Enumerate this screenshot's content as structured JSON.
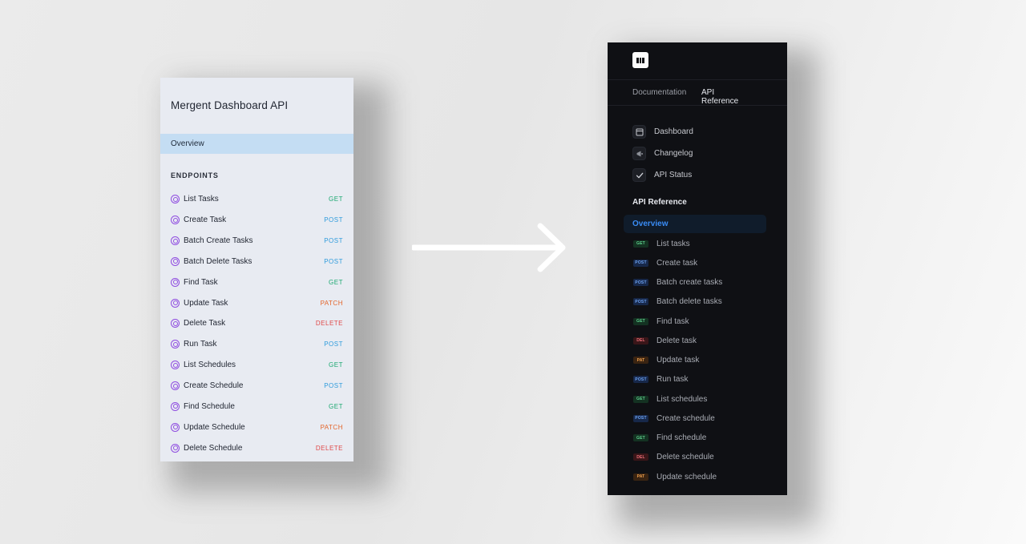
{
  "left_panel": {
    "title": "Mergent Dashboard API",
    "overview": "Overview",
    "section": "ENDPOINTS",
    "items": [
      {
        "label": "List Tasks",
        "method": "GET",
        "kind": "get"
      },
      {
        "label": "Create Task",
        "method": "POST",
        "kind": "post"
      },
      {
        "label": "Batch Create Tasks",
        "method": "POST",
        "kind": "post"
      },
      {
        "label": "Batch Delete Tasks",
        "method": "POST",
        "kind": "post"
      },
      {
        "label": "Find Task",
        "method": "GET",
        "kind": "get"
      },
      {
        "label": "Update Task",
        "method": "PATCH",
        "kind": "patch"
      },
      {
        "label": "Delete Task",
        "method": "DELETE",
        "kind": "delete"
      },
      {
        "label": "Run Task",
        "method": "POST",
        "kind": "post"
      },
      {
        "label": "List Schedules",
        "method": "GET",
        "kind": "get"
      },
      {
        "label": "Create Schedule",
        "method": "POST",
        "kind": "post"
      },
      {
        "label": "Find Schedule",
        "method": "GET",
        "kind": "get"
      },
      {
        "label": "Update Schedule",
        "method": "PATCH",
        "kind": "patch"
      },
      {
        "label": "Delete Schedule",
        "method": "DELETE",
        "kind": "delete"
      }
    ]
  },
  "right_panel": {
    "tabs": {
      "documentation": "Documentation",
      "api_reference": "API Reference"
    },
    "nav": [
      {
        "label": "Dashboard",
        "icon": "layout-icon"
      },
      {
        "label": "Changelog",
        "icon": "megaphone-icon"
      },
      {
        "label": "API Status",
        "icon": "check-icon"
      }
    ],
    "section": "API Reference",
    "overview": "Overview",
    "items": [
      {
        "label": "List tasks",
        "badge": "GET",
        "kind": "get"
      },
      {
        "label": "Create task",
        "badge": "POST",
        "kind": "post"
      },
      {
        "label": "Batch create tasks",
        "badge": "POST",
        "kind": "post"
      },
      {
        "label": "Batch delete tasks",
        "badge": "POST",
        "kind": "post"
      },
      {
        "label": "Find task",
        "badge": "GET",
        "kind": "get"
      },
      {
        "label": "Delete task",
        "badge": "DEL",
        "kind": "del"
      },
      {
        "label": "Update task",
        "badge": "PAT",
        "kind": "pat"
      },
      {
        "label": "Run task",
        "badge": "POST",
        "kind": "post"
      },
      {
        "label": "List schedules",
        "badge": "GET",
        "kind": "get"
      },
      {
        "label": "Create schedule",
        "badge": "POST",
        "kind": "post"
      },
      {
        "label": "Find schedule",
        "badge": "GET",
        "kind": "get"
      },
      {
        "label": "Delete schedule",
        "badge": "DEL",
        "kind": "del"
      },
      {
        "label": "Update schedule",
        "badge": "PAT",
        "kind": "pat"
      }
    ]
  },
  "colors": {
    "accent_blue": "#3a86f5",
    "endpoint_icon_purple": "#8f4ce0",
    "get_green": "#1aa870",
    "post_blue": "#2e9bdc",
    "patch_orange": "#e4652a",
    "delete_red": "#e04848"
  }
}
